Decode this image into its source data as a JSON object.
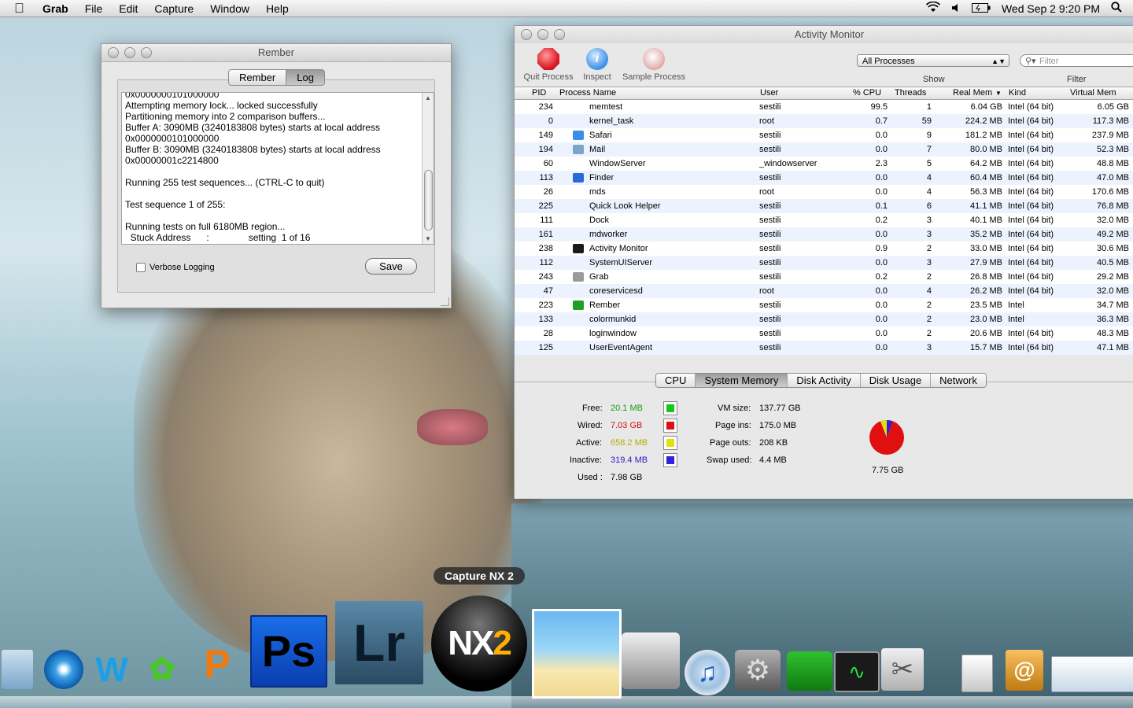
{
  "menubar": {
    "app": "Grab",
    "items": [
      "File",
      "Edit",
      "Capture",
      "Window",
      "Help"
    ],
    "datetime": "Wed Sep 2  9:20 PM"
  },
  "rember": {
    "title": "Rember",
    "tabs": [
      "Rember",
      "Log"
    ],
    "log": "0x0000000101000000\nAttempting memory lock... locked successfully\nPartitioning memory into 2 comparison buffers...\nBuffer A: 3090MB (3240183808 bytes) starts at local address\n0x0000000101000000\nBuffer B: 3090MB (3240183808 bytes) starts at local address\n0x00000001c2214800\n\nRunning 255 test sequences... (CTRL-C to quit)\n\nTest sequence 1 of 255:\n\nRunning tests on full 6180MB region...\n  Stuck Address      :               setting  1 of 16",
    "verbose_label": "Verbose Logging",
    "save_label": "Save"
  },
  "activity": {
    "title": "Activity Monitor",
    "toolbar": {
      "quit": "Quit Process",
      "inspect": "Inspect",
      "sample": "Sample Process"
    },
    "show_label": "Show",
    "filter_label": "Filter",
    "show_value": "All Processes",
    "filter_placeholder": "Filter",
    "columns": {
      "pid": "PID",
      "name": "Process Name",
      "user": "User",
      "cpu": "% CPU",
      "threads": "Threads",
      "realmem": "Real Mem",
      "kind": "Kind",
      "vmem": "Virtual Mem"
    },
    "rows": [
      {
        "pid": "234",
        "name": "memtest",
        "user": "sestili",
        "cpu": "99.5",
        "threads": "1",
        "realmem": "6.04 GB",
        "kind": "Intel (64 bit)",
        "vmem": "6.05 GB"
      },
      {
        "pid": "0",
        "name": "kernel_task",
        "user": "root",
        "cpu": "0.7",
        "threads": "59",
        "realmem": "224.2 MB",
        "kind": "Intel (64 bit)",
        "vmem": "117.3 MB"
      },
      {
        "pid": "149",
        "name": "Safari",
        "user": "sestili",
        "cpu": "0.0",
        "threads": "9",
        "realmem": "181.2 MB",
        "kind": "Intel (64 bit)",
        "vmem": "237.9 MB"
      },
      {
        "pid": "194",
        "name": "Mail",
        "user": "sestili",
        "cpu": "0.0",
        "threads": "7",
        "realmem": "80.0 MB",
        "kind": "Intel (64 bit)",
        "vmem": "52.3 MB"
      },
      {
        "pid": "60",
        "name": "WindowServer",
        "user": "_windowserver",
        "cpu": "2.3",
        "threads": "5",
        "realmem": "64.2 MB",
        "kind": "Intel (64 bit)",
        "vmem": "48.8 MB"
      },
      {
        "pid": "113",
        "name": "Finder",
        "user": "sestili",
        "cpu": "0.0",
        "threads": "4",
        "realmem": "60.4 MB",
        "kind": "Intel (64 bit)",
        "vmem": "47.0 MB"
      },
      {
        "pid": "26",
        "name": "mds",
        "user": "root",
        "cpu": "0.0",
        "threads": "4",
        "realmem": "56.3 MB",
        "kind": "Intel (64 bit)",
        "vmem": "170.6 MB"
      },
      {
        "pid": "225",
        "name": "Quick Look Helper",
        "user": "sestili",
        "cpu": "0.1",
        "threads": "6",
        "realmem": "41.1 MB",
        "kind": "Intel (64 bit)",
        "vmem": "76.8 MB"
      },
      {
        "pid": "111",
        "name": "Dock",
        "user": "sestili",
        "cpu": "0.2",
        "threads": "3",
        "realmem": "40.1 MB",
        "kind": "Intel (64 bit)",
        "vmem": "32.0 MB"
      },
      {
        "pid": "161",
        "name": "mdworker",
        "user": "sestili",
        "cpu": "0.0",
        "threads": "3",
        "realmem": "35.2 MB",
        "kind": "Intel (64 bit)",
        "vmem": "49.2 MB"
      },
      {
        "pid": "238",
        "name": "Activity Monitor",
        "user": "sestili",
        "cpu": "0.9",
        "threads": "2",
        "realmem": "33.0 MB",
        "kind": "Intel (64 bit)",
        "vmem": "30.6 MB"
      },
      {
        "pid": "112",
        "name": "SystemUIServer",
        "user": "sestili",
        "cpu": "0.0",
        "threads": "3",
        "realmem": "27.9 MB",
        "kind": "Intel (64 bit)",
        "vmem": "40.5 MB"
      },
      {
        "pid": "243",
        "name": "Grab",
        "user": "sestili",
        "cpu": "0.2",
        "threads": "2",
        "realmem": "26.8 MB",
        "kind": "Intel (64 bit)",
        "vmem": "29.2 MB"
      },
      {
        "pid": "47",
        "name": "coreservicesd",
        "user": "root",
        "cpu": "0.0",
        "threads": "4",
        "realmem": "26.2 MB",
        "kind": "Intel (64 bit)",
        "vmem": "32.0 MB"
      },
      {
        "pid": "223",
        "name": "Rember",
        "user": "sestili",
        "cpu": "0.0",
        "threads": "2",
        "realmem": "23.5 MB",
        "kind": "Intel",
        "vmem": "34.7 MB"
      },
      {
        "pid": "133",
        "name": "colormunkid",
        "user": "sestili",
        "cpu": "0.0",
        "threads": "2",
        "realmem": "23.0 MB",
        "kind": "Intel",
        "vmem": "36.3 MB"
      },
      {
        "pid": "28",
        "name": "loginwindow",
        "user": "sestili",
        "cpu": "0.0",
        "threads": "2",
        "realmem": "20.6 MB",
        "kind": "Intel (64 bit)",
        "vmem": "48.3 MB"
      },
      {
        "pid": "125",
        "name": "UserEventAgent",
        "user": "sestili",
        "cpu": "0.0",
        "threads": "3",
        "realmem": "15.7 MB",
        "kind": "Intel (64 bit)",
        "vmem": "47.1 MB"
      }
    ],
    "bottom_tabs": [
      "CPU",
      "System Memory",
      "Disk Activity",
      "Disk Usage",
      "Network"
    ],
    "memory": {
      "free_label": "Free:",
      "free": "20.1 MB",
      "wired_label": "Wired:",
      "wired": "7.03 GB",
      "active_label": "Active:",
      "active": "658.2 MB",
      "inactive_label": "Inactive:",
      "inactive": "319.4 MB",
      "used_label": "Used :",
      "used": "7.98 GB",
      "vmsize_label": "VM size:",
      "vmsize": "137.77 GB",
      "pageins_label": "Page ins:",
      "pageins": "175.0 MB",
      "pageouts_label": "Page outs:",
      "pageouts": "208 KB",
      "swap_label": "Swap used:",
      "swap": "4.4 MB",
      "total": "7.75 GB"
    },
    "colors": {
      "free": "#16c616",
      "wired": "#e01010",
      "active": "#e0e010",
      "inactive": "#3020e0"
    }
  },
  "dock": {
    "tooltip": "Capture NX 2",
    "icons": [
      "mail-stamp-icon",
      "safari-icon",
      "iwork-w-icon",
      "messenger-icon",
      "pages-icon",
      "photoshop-icon",
      "lightroom-icon",
      "capture-nx2-icon",
      "iphoto-icon",
      "image-capture-icon",
      "itunes-icon",
      "system-preferences-icon",
      "time-capsule-icon",
      "activity-monitor-icon",
      "grab-icon",
      "file-icon",
      "address-book-icon",
      "finder-window-icon"
    ]
  }
}
